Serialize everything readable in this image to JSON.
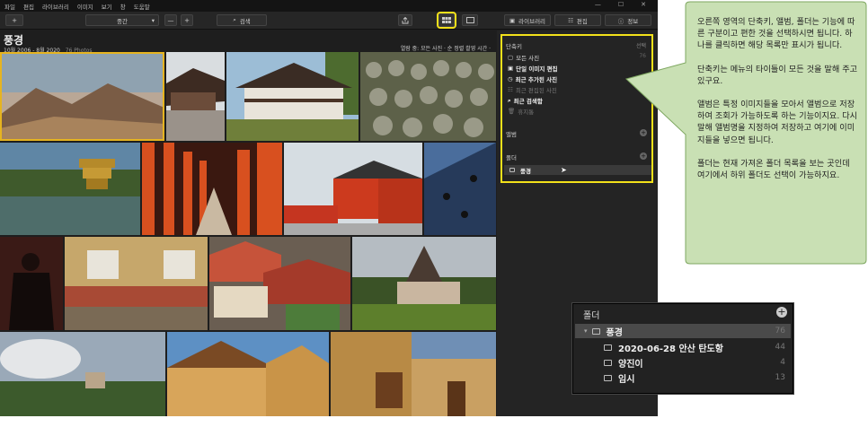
{
  "menu": [
    "파일",
    "편집",
    "라이브러리",
    "이미지",
    "보기",
    "창",
    "도움말"
  ],
  "window_controls": [
    "—",
    "☐",
    "✕"
  ],
  "toolbar": {
    "add_label": "+",
    "sort_label": "중간",
    "minus_label": "—",
    "plus_label": "+",
    "search_label": "검색",
    "tabs": {
      "library": "라이브러리",
      "edit": "편집",
      "info": "정보"
    }
  },
  "header": {
    "title": "풍경",
    "date_range": "10월 2006 - 8월 2020",
    "photo_count": "76 Photos",
    "sort_text": "열람 중:  모든 사진 ·  순 정렬 촬영 시간 ·"
  },
  "sidebar": {
    "shortcuts_title": "단축키",
    "shortcuts_action": "선택",
    "shortcuts": [
      {
        "label": "모든 사진",
        "count": "76",
        "style": "normal"
      },
      {
        "label": "단일 이미지 편집",
        "count": "",
        "style": "bold"
      },
      {
        "label": "최근 추가된 사진",
        "count": "",
        "style": "bold"
      },
      {
        "label": "최근 편집된 사진",
        "count": "",
        "style": "dim"
      },
      {
        "label": "최근 검색함",
        "count": "",
        "style": "bold"
      },
      {
        "label": "휴지통",
        "count": "",
        "style": "dim"
      }
    ],
    "albums_title": "앨범",
    "folders_title": "폴더",
    "folder_item": "풍경"
  },
  "callout": {
    "paragraphs": [
      "오른쪽 영역의 단축키, 앨범, 폴더는 기능에 따른 구분이고 편한 것을 선택하시면 됩니다. 하나를 클릭하면 해당 목록만 표시가 됩니다.",
      "단축키는 메뉴의 타이틀이 모든 것을 말해 주고 있구요.",
      "앨범은 특정 이미지들을 모아서 앨범으로 저장하여 조회가 가능하도록 하는 기능이지요. 다시 말해 앨범명을 지정하여 저장하고 여기에 이미지들을 넣으면 됩니다.",
      "폴더는 현재 가져온 폴더 목록을 보는 곳인데 여기에서 하위 폴더도 선택이 가능하지요."
    ]
  },
  "zoom_panel": {
    "title": "폴더",
    "rows": [
      {
        "label": "풍경",
        "count": "76"
      },
      {
        "label": "2020-06-28 안산 탄도항",
        "count": "44"
      },
      {
        "label": "양진이",
        "count": "4"
      },
      {
        "label": "임시",
        "count": "13"
      }
    ]
  },
  "colors": {
    "highlight": "#f3e11a",
    "callout_fill": "#c9e0b4",
    "callout_stroke": "#7ea760"
  }
}
